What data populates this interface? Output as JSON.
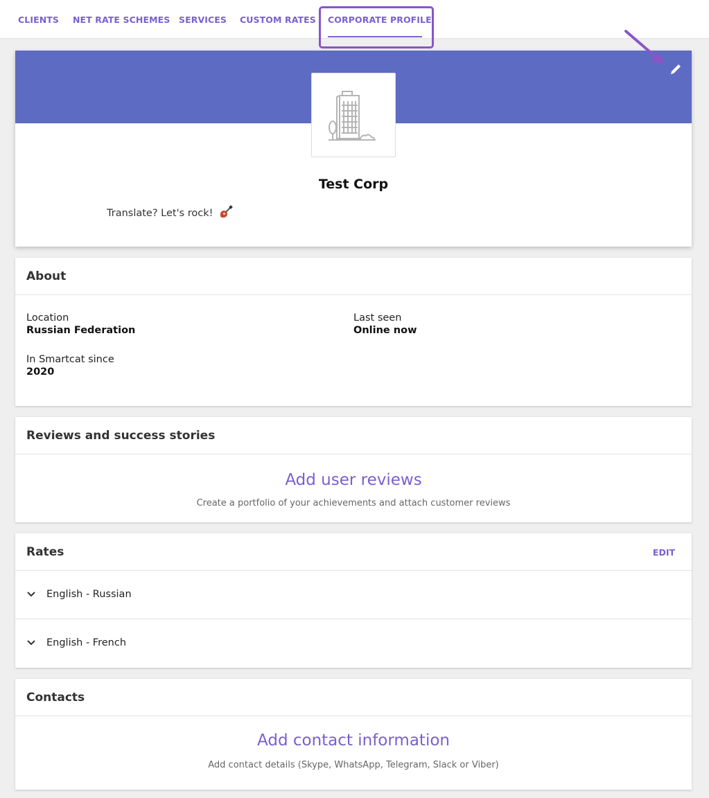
{
  "tabs": [
    {
      "label": "CLIENTS"
    },
    {
      "label": "NET RATE SCHEMES"
    },
    {
      "label": "SERVICES"
    },
    {
      "label": "CUSTOM RATES"
    },
    {
      "label": "CORPORATE PROFILE",
      "active": true
    }
  ],
  "profile": {
    "company_name": "Test Corp",
    "tagline": "Translate? Let's rock!",
    "banner_color": "#5d6bc2",
    "edit_icon": "pencil-icon",
    "logo_icon": "building-icon",
    "tagline_icon": "guitar-icon"
  },
  "about": {
    "title": "About",
    "location": {
      "label": "Location",
      "value": "Russian Federation"
    },
    "last_seen": {
      "label": "Last seen",
      "value": "Online now"
    },
    "since": {
      "label": "In Smartcat since",
      "value": "2020"
    }
  },
  "reviews": {
    "title": "Reviews and success stories",
    "empty_title": "Add user reviews",
    "empty_sub": "Create a portfolio of your achievements and attach customer reviews"
  },
  "rates": {
    "title": "Rates",
    "edit_label": "EDIT",
    "items": [
      {
        "label": "English - Russian"
      },
      {
        "label": "English - French"
      }
    ]
  },
  "contacts": {
    "title": "Contacts",
    "empty_title": "Add contact information",
    "empty_sub": "Add contact details (Skype, WhatsApp, Telegram, Slack or Viber)"
  },
  "colors": {
    "accent": "#7a5fd0",
    "annotation": "#8a55c6"
  }
}
